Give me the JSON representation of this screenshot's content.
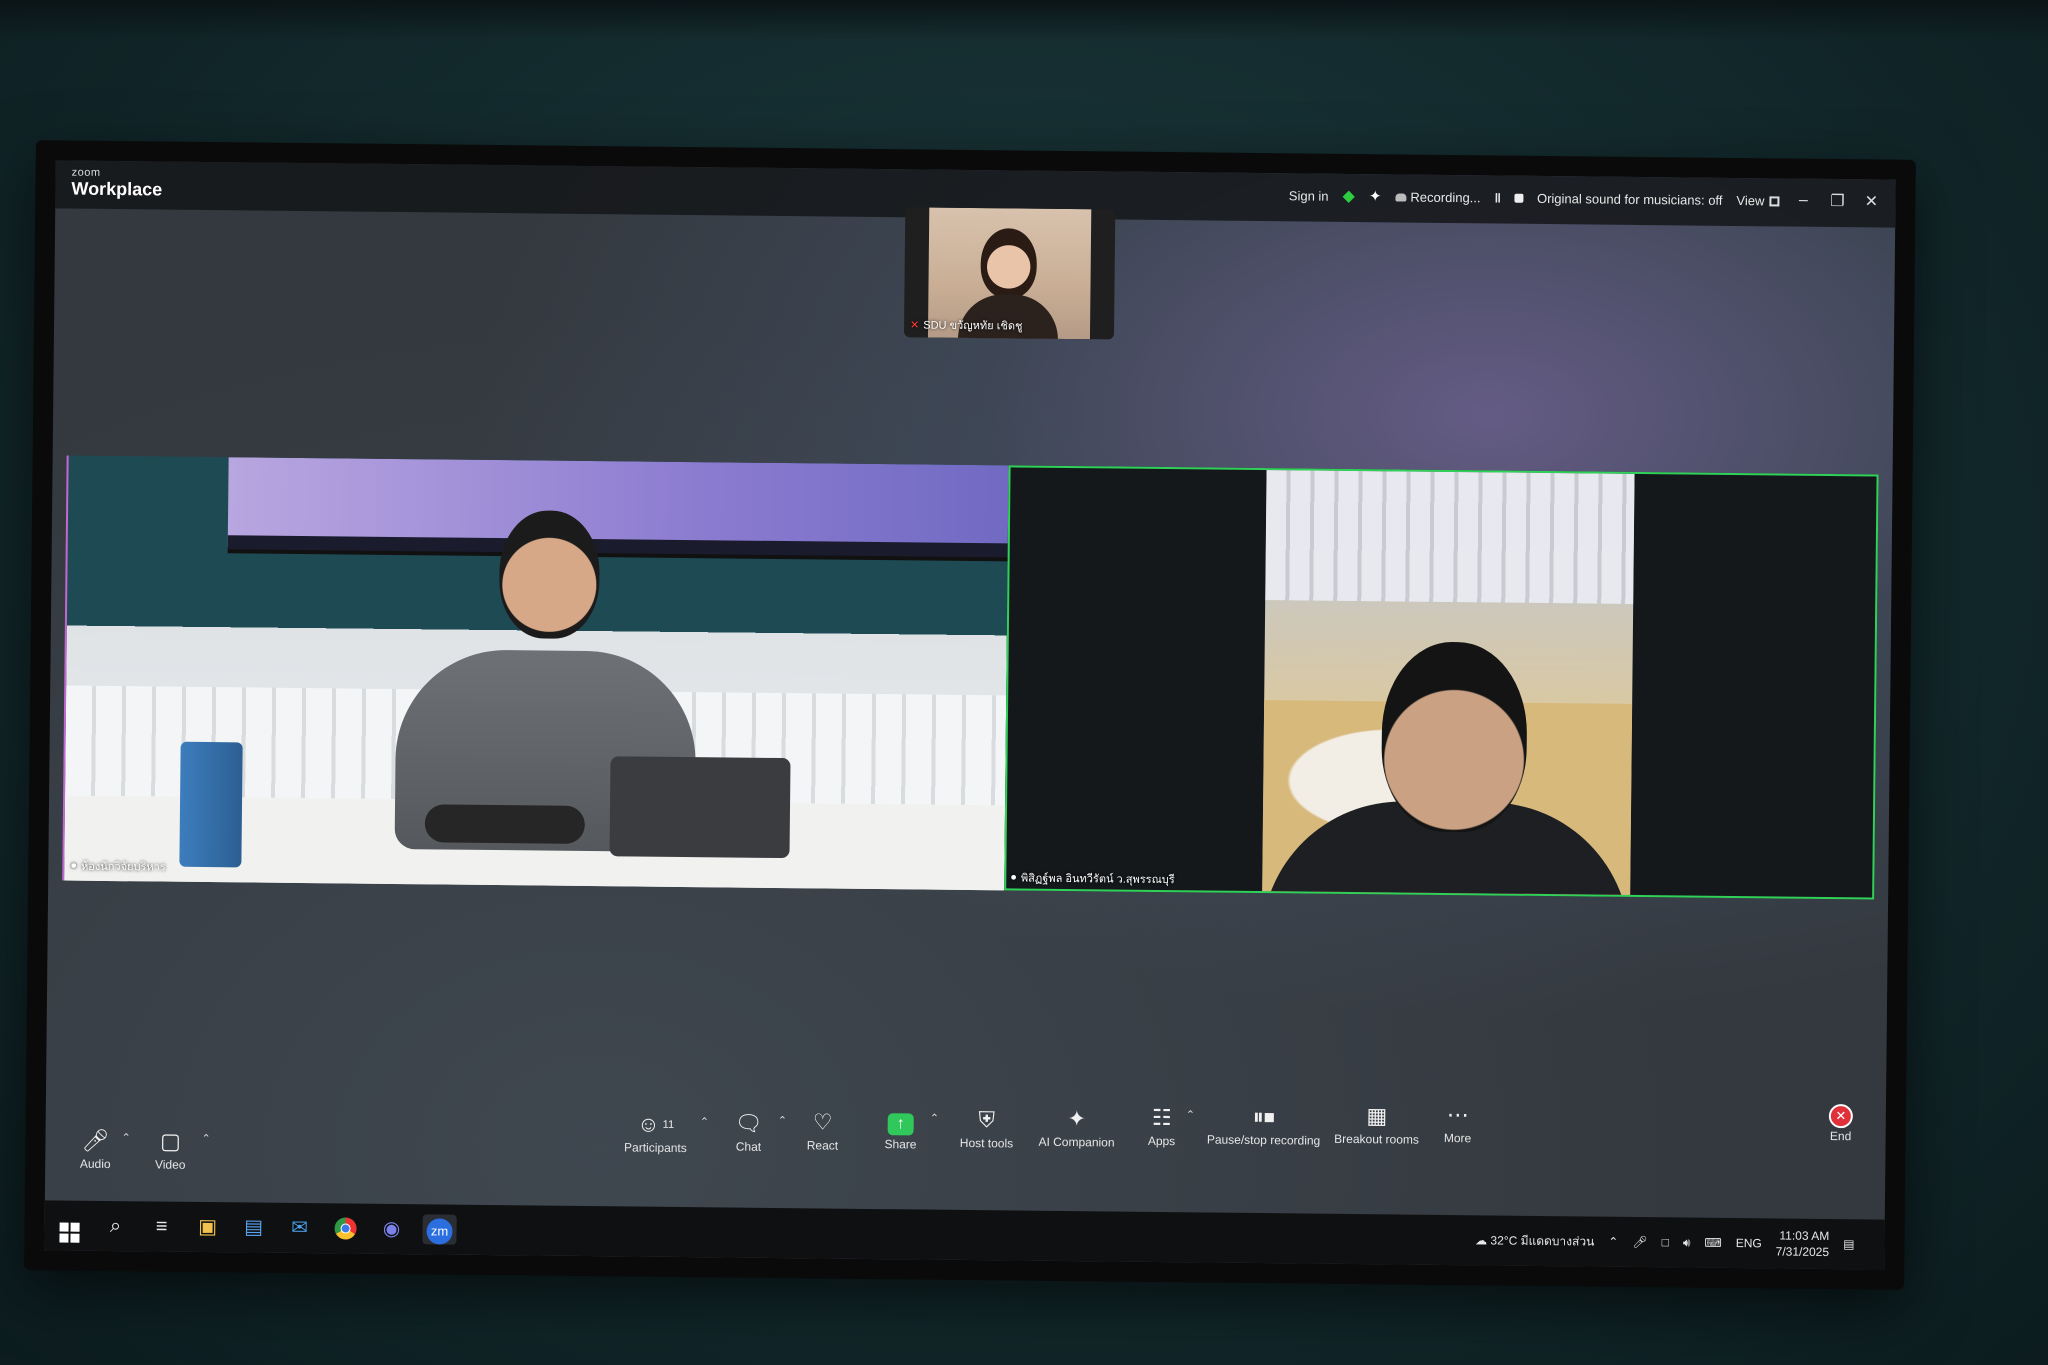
{
  "titlebar": {
    "logo_small": "zoom",
    "logo_big": "Workplace",
    "sign_in": "Sign in",
    "recording": "Recording...",
    "original_sound": "Original sound for musicians: off",
    "view": "View"
  },
  "participants_video": {
    "thumbnail": {
      "name": "SDU ขวัญหทัย เชิดชู"
    },
    "left": {
      "name": "ห้องนักวิจัยบริหาร"
    },
    "right": {
      "name": "พิสิฏฐ์พล อินทวีรัตน์ ว.สุพรรณบุรี"
    }
  },
  "toolbar": {
    "audio": "Audio",
    "video": "Video",
    "participants": "Participants",
    "participants_count": "11",
    "chat": "Chat",
    "react": "React",
    "share": "Share",
    "host_tools": "Host tools",
    "ai_companion": "AI Companion",
    "apps": "Apps",
    "pause_stop_recording": "Pause/stop recording",
    "breakout_rooms": "Breakout rooms",
    "more": "More",
    "end": "End"
  },
  "taskbar": {
    "weather": "32°C มีแดดบางส่วน",
    "language": "ENG",
    "time": "11:03 AM",
    "date": "7/31/2025",
    "zoom_app": "zm"
  },
  "colors": {
    "active_speaker_border": "#30d158",
    "share_green": "#30c75b",
    "end_red": "#e0303a"
  }
}
